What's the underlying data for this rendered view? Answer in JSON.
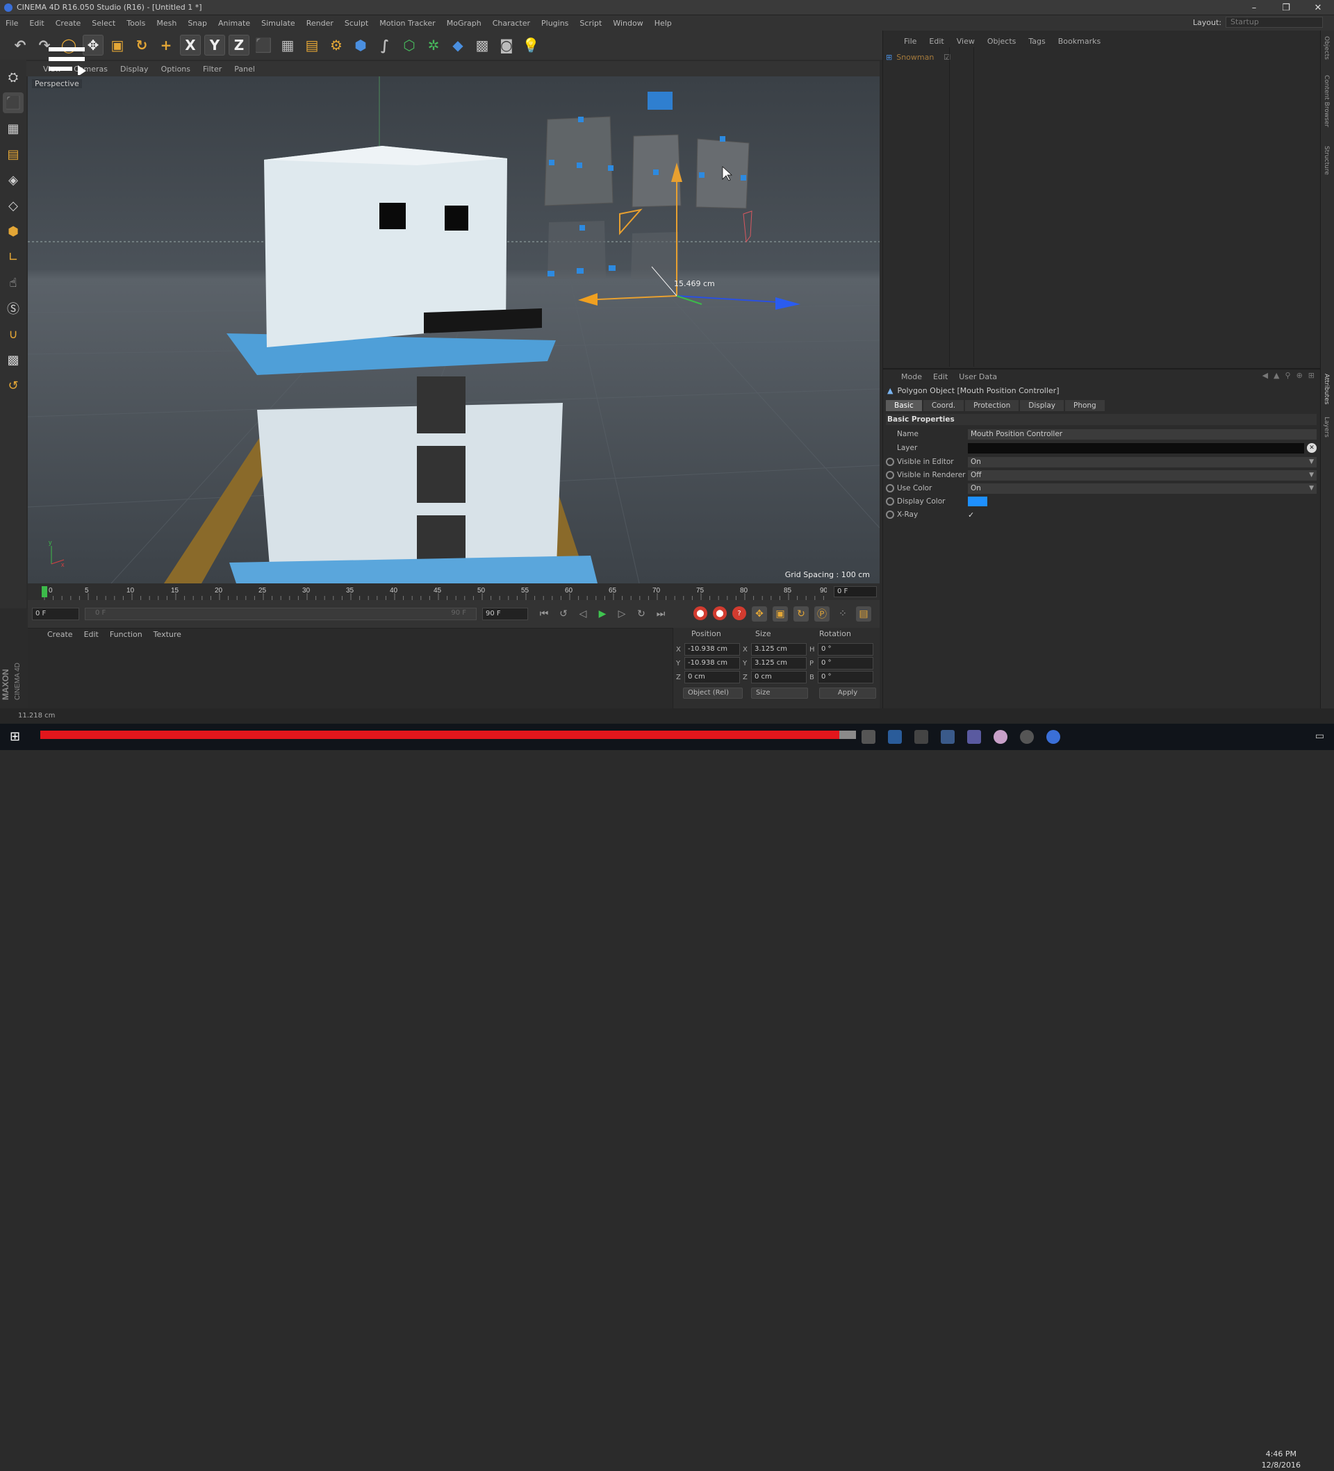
{
  "window": {
    "title": "CINEMA 4D R16.050 Studio (R16) - [Untitled 1 *]",
    "min": "–",
    "max": "❐",
    "close": "✕"
  },
  "menubar": [
    "File",
    "Edit",
    "Create",
    "Select",
    "Tools",
    "Mesh",
    "Snap",
    "Animate",
    "Simulate",
    "Render",
    "Sculpt",
    "Motion Tracker",
    "MoGraph",
    "Character",
    "Plugins",
    "Script",
    "Window",
    "Help"
  ],
  "layout": {
    "label": "Layout:",
    "value": "Startup"
  },
  "toolbar": {
    "x": "X",
    "y": "Y",
    "z": "Z"
  },
  "viewport": {
    "menu": [
      "View",
      "Cameras",
      "Display",
      "Options",
      "Filter",
      "Panel"
    ],
    "label": "Perspective",
    "grid_spacing": "Grid Spacing : 100 cm",
    "measure": "15.469 cm"
  },
  "timeline": {
    "ticks": [
      "0",
      "5",
      "10",
      "15",
      "20",
      "25",
      "30",
      "35",
      "40",
      "45",
      "50",
      "55",
      "60",
      "65",
      "70",
      "75",
      "80",
      "85",
      "90"
    ],
    "current_frame": "0 F",
    "start_frame": "0 F",
    "range_start": "0 F",
    "range_end": "90 F",
    "end_frame": "90 F"
  },
  "material_menu": [
    "Create",
    "Edit",
    "Function",
    "Texture"
  ],
  "coords": {
    "headers": {
      "position": "Position",
      "size": "Size",
      "rotation": "Rotation"
    },
    "rows": [
      {
        "axis": "X",
        "pos": "-10.938 cm",
        "saxis": "X",
        "size": "3.125 cm",
        "raxis": "H",
        "rot": "0 °"
      },
      {
        "axis": "Y",
        "pos": "-10.938 cm",
        "saxis": "Y",
        "size": "3.125 cm",
        "raxis": "P",
        "rot": "0 °"
      },
      {
        "axis": "Z",
        "pos": "0 cm",
        "saxis": "Z",
        "size": "0 cm",
        "raxis": "B",
        "rot": "0 °"
      }
    ],
    "mode_dropdown": "Object (Rel)",
    "size_dropdown": "Size",
    "apply": "Apply"
  },
  "status": {
    "text": "11.218 cm"
  },
  "object_manager": {
    "menu": [
      "File",
      "Edit",
      "View",
      "Objects",
      "Tags",
      "Bookmarks"
    ],
    "object_name": "Snowman"
  },
  "attributes": {
    "menu": [
      "Mode",
      "Edit",
      "User Data"
    ],
    "title": "Polygon Object [Mouth Position Controller]",
    "tabs": [
      "Basic",
      "Coord.",
      "Protection",
      "Display",
      "Phong"
    ],
    "section": "Basic Properties",
    "name_label": "Name",
    "name_value": "Mouth Position Controller",
    "layer_label": "Layer",
    "vis_editor_label": "Visible in Editor",
    "vis_editor_value": "On",
    "vis_render_label": "Visible in Renderer",
    "vis_render_value": "Off",
    "use_color_label": "Use Color",
    "use_color_value": "On",
    "display_color_label": "Display Color",
    "xray_label": "X-Ray",
    "xray_value": "✓",
    "display_color": "#1e90ff"
  },
  "right_strip": [
    "Objects",
    "Content Browser",
    "Structure",
    "Attributes",
    "Layers"
  ],
  "taskbar": {
    "time": "4:46 PM",
    "date": "12/8/2016"
  },
  "brand": {
    "maxon": "MAXON",
    "c4d": "CINEMA 4D"
  }
}
